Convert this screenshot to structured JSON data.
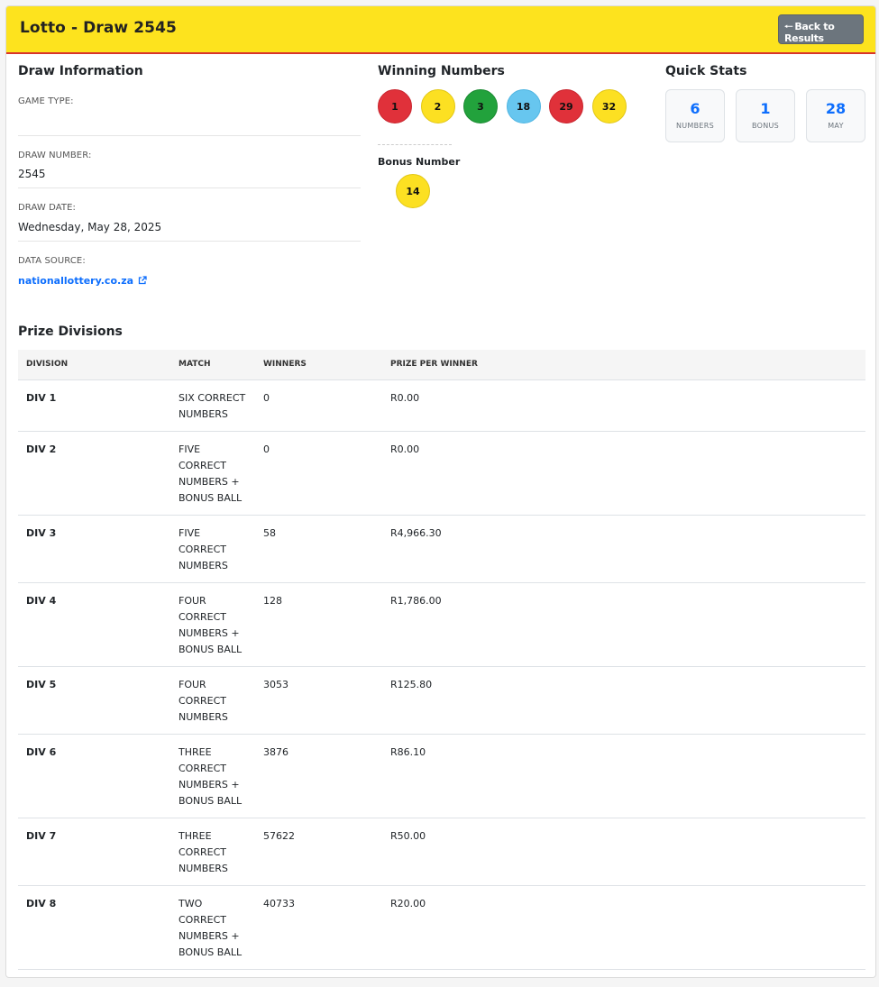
{
  "header": {
    "title": "Lotto - Draw 2545",
    "back_label": "Back to Results"
  },
  "draw_info": {
    "section_title": "Draw Information",
    "game_type_label": "GAME TYPE:",
    "game_type_value": "",
    "draw_number_label": "DRAW NUMBER:",
    "draw_number_value": "2545",
    "draw_date_label": "DRAW DATE:",
    "draw_date_value": "Wednesday, May 28, 2025",
    "data_source_label": "DATA SOURCE:",
    "data_source_value": "nationallottery.co.za"
  },
  "winning": {
    "section_title": "Winning Numbers",
    "balls": [
      {
        "number": "1",
        "color": "#e0313a"
      },
      {
        "number": "2",
        "color": "#fce022"
      },
      {
        "number": "3",
        "color": "#22a23c"
      },
      {
        "number": "18",
        "color": "#67c6ef"
      },
      {
        "number": "29",
        "color": "#e0313a"
      },
      {
        "number": "32",
        "color": "#fce022"
      }
    ],
    "bonus_label": "Bonus Number",
    "bonus_ball": {
      "number": "14",
      "color": "#fce022"
    }
  },
  "quick_stats": {
    "section_title": "Quick Stats",
    "items": [
      {
        "value": "6",
        "label": "NUMBERS"
      },
      {
        "value": "1",
        "label": "BONUS"
      },
      {
        "value": "28",
        "label": "MAY"
      }
    ]
  },
  "prize_divisions": {
    "section_title": "Prize Divisions",
    "columns": [
      "DIVISION",
      "MATCH",
      "WINNERS",
      "PRIZE PER WINNER"
    ],
    "rows": [
      {
        "division": "DIV 1",
        "match": "SIX CORRECT NUMBERS",
        "winners": "0",
        "prize": "R0.00"
      },
      {
        "division": "DIV 2",
        "match": "FIVE CORRECT NUMBERS + BONUS BALL",
        "winners": "0",
        "prize": "R0.00"
      },
      {
        "division": "DIV 3",
        "match": "FIVE CORRECT NUMBERS",
        "winners": "58",
        "prize": "R4,966.30"
      },
      {
        "division": "DIV 4",
        "match": "FOUR CORRECT NUMBERS + BONUS BALL",
        "winners": "128",
        "prize": "R1,786.00"
      },
      {
        "division": "DIV 5",
        "match": "FOUR CORRECT NUMBERS",
        "winners": "3053",
        "prize": "R125.80"
      },
      {
        "division": "DIV 6",
        "match": "THREE CORRECT NUMBERS + BONUS BALL",
        "winners": "3876",
        "prize": "R86.10"
      },
      {
        "division": "DIV 7",
        "match": "THREE CORRECT NUMBERS",
        "winners": "57622",
        "prize": "R50.00"
      },
      {
        "division": "DIV 8",
        "match": "TWO CORRECT NUMBERS + BONUS BALL",
        "winners": "40733",
        "prize": "R20.00"
      }
    ]
  },
  "colors": {
    "header_bg": "#fde31e",
    "header_border": "#d8342a",
    "accent": "#0d6efd",
    "button_bg": "#6c757d"
  }
}
